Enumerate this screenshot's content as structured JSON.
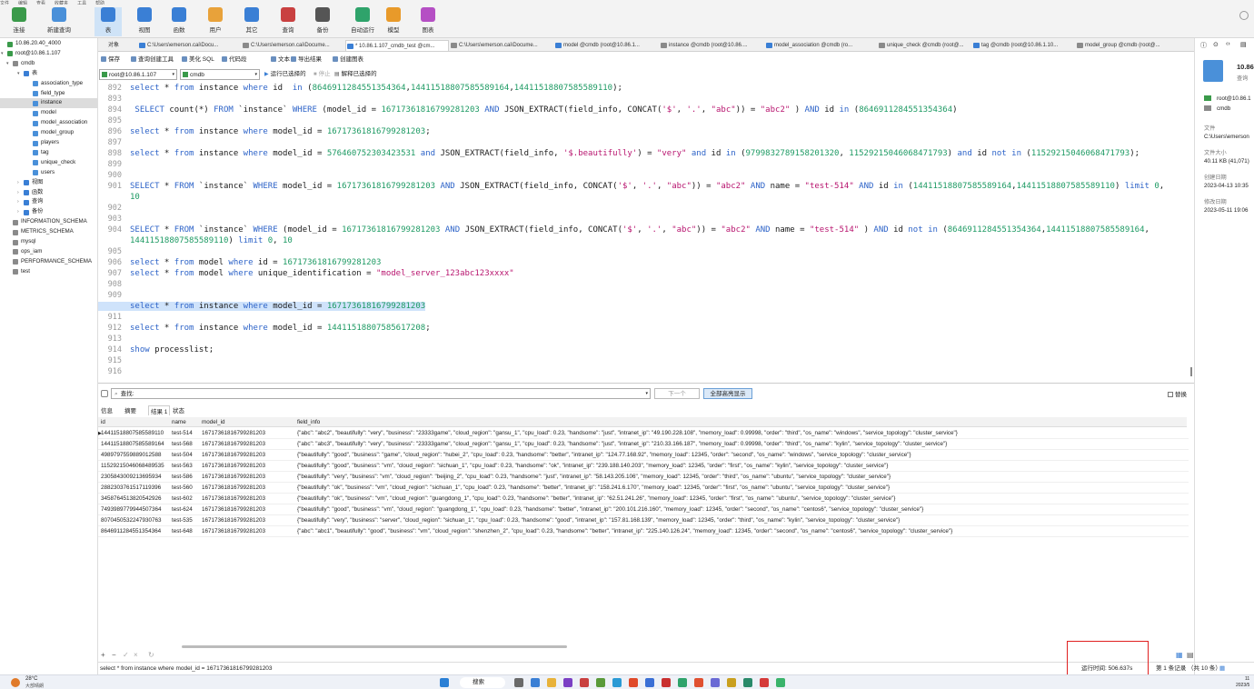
{
  "menubar": [
    "文件",
    "编辑",
    "查看",
    "收藏夹",
    "工具",
    "帮助"
  ],
  "toolbar": {
    "items": [
      {
        "label": "连接",
        "icon": "connect-icon",
        "color": "#3a9a4a"
      },
      {
        "label": "新建查询",
        "icon": "new-query-icon",
        "color": "#4a90d9"
      },
      {
        "label": "表",
        "icon": "table-icon",
        "color": "#3a7fd5"
      },
      {
        "label": "视图",
        "icon": "view-icon",
        "color": "#3a7fd5"
      },
      {
        "label": "函数",
        "icon": "function-icon",
        "color": "#3a7fd5"
      },
      {
        "label": "用户",
        "icon": "user-icon",
        "color": "#e8a23a"
      },
      {
        "label": "其它",
        "icon": "other-icon",
        "color": "#3a7fd5"
      },
      {
        "label": "查询",
        "icon": "query-icon",
        "color": "#c94040"
      },
      {
        "label": "备份",
        "icon": "backup-icon",
        "color": "#555"
      },
      {
        "label": "自动运行",
        "icon": "automation-icon",
        "color": "#2fa36b"
      },
      {
        "label": "模型",
        "icon": "model-icon",
        "color": "#e89a2a"
      },
      {
        "label": "图表",
        "icon": "chart-icon",
        "color": "#b54fc4"
      }
    ]
  },
  "tree": [
    {
      "label": "10.86.20.40_4000",
      "level": 0,
      "type": "connection",
      "expand": ""
    },
    {
      "label": "root@10.86.1.107",
      "level": 0,
      "type": "connection",
      "expand": "▾"
    },
    {
      "label": "cmdb",
      "level": 1,
      "type": "db",
      "expand": "▾"
    },
    {
      "label": "表",
      "level": 2,
      "type": "folder",
      "expand": "▾"
    },
    {
      "label": "association_type",
      "level": 3,
      "type": "table",
      "expand": ""
    },
    {
      "label": "field_type",
      "level": 3,
      "type": "table",
      "expand": ""
    },
    {
      "label": "instance",
      "level": 3,
      "type": "table",
      "expand": "",
      "selected": true
    },
    {
      "label": "model",
      "level": 3,
      "type": "table",
      "expand": ""
    },
    {
      "label": "model_association",
      "level": 3,
      "type": "table",
      "expand": ""
    },
    {
      "label": "model_group",
      "level": 3,
      "type": "table",
      "expand": ""
    },
    {
      "label": "players",
      "level": 3,
      "type": "table",
      "expand": ""
    },
    {
      "label": "tag",
      "level": 3,
      "type": "table",
      "expand": ""
    },
    {
      "label": "unique_check",
      "level": 3,
      "type": "table",
      "expand": ""
    },
    {
      "label": "users",
      "level": 3,
      "type": "table",
      "expand": ""
    },
    {
      "label": "视图",
      "level": 2,
      "type": "folder",
      "expand": "›"
    },
    {
      "label": "函数",
      "level": 2,
      "type": "folder",
      "expand": "›"
    },
    {
      "label": "查询",
      "level": 2,
      "type": "folder",
      "expand": "›"
    },
    {
      "label": "备份",
      "level": 2,
      "type": "folder",
      "expand": "›"
    },
    {
      "label": "INFORMATION_SCHEMA",
      "level": 1,
      "type": "db",
      "expand": ""
    },
    {
      "label": "METRICS_SCHEMA",
      "level": 1,
      "type": "db",
      "expand": ""
    },
    {
      "label": "mysql",
      "level": 1,
      "type": "db",
      "expand": ""
    },
    {
      "label": "ops_iam",
      "level": 1,
      "type": "db",
      "expand": ""
    },
    {
      "label": "PERFORMANCE_SCHEMA",
      "level": 1,
      "type": "db",
      "expand": ""
    },
    {
      "label": "test",
      "level": 1,
      "type": "db",
      "expand": ""
    }
  ],
  "tabs": [
    {
      "label": "对象",
      "active": false
    },
    {
      "label": "C:\\Users\\emerson.cai\\Docu...",
      "active": false
    },
    {
      "label": "C:\\Users\\emerson.cai\\Docume...",
      "active": false
    },
    {
      "label": "* 10.86.1.107_cmdb_test @cm...",
      "active": true
    },
    {
      "label": "C:\\Users\\emerson.cai\\Docume...",
      "active": false
    },
    {
      "label": "model @cmdb (root@10.86.1...",
      "active": false
    },
    {
      "label": "instance @cmdb (root@10.86....",
      "active": false
    },
    {
      "label": "model_association @cmdb (ro...",
      "active": false
    },
    {
      "label": "unique_check @cmdb (root@...",
      "active": false
    },
    {
      "label": "tag @cmdb (root@10.86.1.10...",
      "active": false
    },
    {
      "label": "model_group @cmdb (root@...",
      "active": false
    }
  ],
  "subtoolbar": [
    "保存",
    "查询创建工具",
    "美化 SQL",
    "代码段",
    "文本",
    "导出结果",
    "创建图表"
  ],
  "conbar": {
    "connection": "root@10.86.1.107",
    "database": "cmdb",
    "run": "运行已选择的",
    "stop": "停止",
    "explain": "解释已选择的"
  },
  "editor": [
    {
      "n": "892",
      "t": "select * from instance where id  in (8646911284551354364,14411518807585589164,14411518807585589110);"
    },
    {
      "n": "893",
      "t": ""
    },
    {
      "n": "894",
      "t": " SELECT count(*) FROM `instance` WHERE (model_id = 1671736181679928​1203 AND JSON_EXTRACT(field_info, CONCAT('$', '.', \"abc\")) = \"abc2\" ) AND id in (8646911284551354364)"
    },
    {
      "n": "895",
      "t": ""
    },
    {
      "n": "896",
      "t": "select * from instance where model_id = 16717361816799281203;"
    },
    {
      "n": "897",
      "t": ""
    },
    {
      "n": "898",
      "t": "select * from instance where model_id = 576460752303423531 and JSON_EXTRACT(field_info, '$.beautifully') = \"very\" and id in (9799832789158201320, 11529215046068471793) and id not in (11529215046068471793);"
    },
    {
      "n": "899",
      "t": ""
    },
    {
      "n": "900",
      "t": ""
    },
    {
      "n": "901",
      "t": "SELECT * FROM `instance` WHERE model_id = 16717361816799281203 AND JSON_EXTRACT(field_info, CONCAT('$', '.', \"abc\")) = \"abc2\" AND name = \"test-514\" AND id in (14411518807585589164,14411518807585589110) limit 0,"
    },
    {
      "n": "",
      "t": "10"
    },
    {
      "n": "902",
      "t": ""
    },
    {
      "n": "903",
      "t": ""
    },
    {
      "n": "904",
      "t": "SELECT * FROM `instance` WHERE (model_id = 16717361816799281203 AND JSON_EXTRACT(field_info, CONCAT('$', '.', \"abc\")) = \"abc2\" AND name = \"test-514\" ) AND id not in (8646911284551354364,14411518807585589164,"
    },
    {
      "n": "",
      "t": "14411518807585589110) limit 0, 10"
    },
    {
      "n": "905",
      "t": ""
    },
    {
      "n": "906",
      "t": "select * from model where id = 16717361816799281203"
    },
    {
      "n": "907",
      "t": "select * from model where unique_identification = \"model_server_123abc123xxxx\""
    },
    {
      "n": "908",
      "t": ""
    },
    {
      "n": "909",
      "t": ""
    },
    {
      "n": "910",
      "t": "select * from instance where model_id = 16717361816799281203",
      "hl": true
    },
    {
      "n": "911",
      "t": ""
    },
    {
      "n": "912",
      "t": "select * from instance where model_id = 14411518807585617208;"
    },
    {
      "n": "913",
      "t": ""
    },
    {
      "n": "914",
      "t": "show processlist;"
    },
    {
      "n": "915",
      "t": ""
    },
    {
      "n": "916",
      "t": ""
    }
  ],
  "find": {
    "label": "查找:",
    "next": "下一个",
    "highlight_all": "全部高亮显示",
    "replace": "替换"
  },
  "result_tabs": [
    "信息",
    "摘要",
    "结果 1",
    "状态"
  ],
  "grid": {
    "columns": [
      "id",
      "name",
      "model_id",
      "field_info"
    ],
    "rows": [
      [
        "14411518807585589110",
        "test-514",
        "16717361816799281203",
        "{\"abc\": \"abc2\", \"beautifully\": \"very\", \"business\": \"23333game\", \"cloud_region\": \"gansu_1\", \"cpu_load\": 0.23, \"handsome\": \"just\", \"intranet_ip\": \"49.190.228.108\", \"memory_load\": 0.99998, \"order\": \"third\", \"os_name\": \"windows\", \"service_topology\": \"cluster_service\"}"
      ],
      [
        "14411518807585589164",
        "test-568",
        "16717361816799281203",
        "{\"abc\": \"abc3\", \"beautifully\": \"very\", \"business\": \"23333game\", \"cloud_region\": \"gansu_1\", \"cpu_load\": 0.23, \"handsome\": \"just\", \"intranet_ip\": \"210.33.166.187\", \"memory_load\": 0.99998, \"order\": \"third\", \"os_name\": \"kylin\", \"service_topology\": \"cluster_service\"}"
      ],
      [
        "4989797559889012588",
        "test-504",
        "16717361816799281203",
        "{\"beautifully\": \"good\", \"business\": \"game\", \"cloud_region\": \"hubei_2\", \"cpu_load\": 0.23, \"handsome\": \"better\", \"intranet_ip\": \"124.77.168.92\", \"memory_load\": 12345, \"order\": \"second\", \"os_name\": \"windows\", \"service_topology\": \"cluster_service\"}"
      ],
      [
        "11529215046068489535",
        "test-563",
        "16717361816799281203",
        "{\"beautifully\": \"good\", \"business\": \"vm\", \"cloud_region\": \"sichuan_1\", \"cpu_load\": 0.23, \"handsome\": \"ok\", \"intranet_ip\": \"239.188.140.203\", \"memory_load\": 12345, \"order\": \"first\", \"os_name\": \"kylin\", \"service_topology\": \"cluster_service\"}"
      ],
      [
        "2305843009213695934",
        "test-586",
        "16717361816799281203",
        "{\"beautifully\": \"very\", \"business\": \"vm\", \"cloud_region\": \"beijing_2\", \"cpu_load\": 0.23, \"handsome\": \"just\", \"intranet_ip\": \"58.143.205.106\", \"memory_load\": 12345, \"order\": \"third\", \"os_name\": \"ubuntu\", \"service_topology\": \"cluster_service\"}"
      ],
      [
        "2882303761517119396",
        "test-560",
        "16717361816799281203",
        "{\"beautifully\": \"ok\", \"business\": \"vm\", \"cloud_region\": \"sichuan_1\", \"cpu_load\": 0.23, \"handsome\": \"better\", \"intranet_ip\": \"158.241.6.170\", \"memory_load\": 12345, \"order\": \"first\", \"os_name\": \"ubuntu\", \"service_topology\": \"cluster_service\"}"
      ],
      [
        "3458764513820542926",
        "test-602",
        "16717361816799281203",
        "{\"beautifully\": \"ok\", \"business\": \"vm\", \"cloud_region\": \"guangdong_1\", \"cpu_load\": 0.23, \"handsome\": \"better\", \"intranet_ip\": \"62.51.241.26\", \"memory_load\": 12345, \"order\": \"first\", \"os_name\": \"ubuntu\", \"service_topology\": \"cluster_service\"}"
      ],
      [
        "7493989779944507364",
        "test-624",
        "16717361816799281203",
        "{\"beautifully\": \"good\", \"business\": \"vm\", \"cloud_region\": \"guangdong_1\", \"cpu_load\": 0.23, \"handsome\": \"better\", \"intranet_ip\": \"200.101.216.160\", \"memory_load\": 12345, \"order\": \"second\", \"os_name\": \"centos6\", \"service_topology\": \"cluster_service\"}"
      ],
      [
        "8070450532247930763",
        "test-535",
        "16717361816799281203",
        "{\"beautifully\": \"very\", \"business\": \"server\", \"cloud_region\": \"sichuan_1\", \"cpu_load\": 0.23, \"handsome\": \"good\", \"intranet_ip\": \"157.81.168.139\", \"memory_load\": 12345, \"order\": \"third\", \"os_name\": \"kylin\", \"service_topology\": \"cluster_service\"}"
      ],
      [
        "8646911284551354364",
        "test-648",
        "16717361816799281203",
        "{\"abc\": \"abc1\", \"beautifully\": \"good\", \"business\": \"vm\", \"cloud_region\": \"shenzhen_2\", \"cpu_load\": 0.23, \"handsome\": \"better\", \"intranet_ip\": \"225.140.126.24\", \"memory_load\": 12345, \"order\": \"second\", \"os_name\": \"centos6\", \"service_topology\": \"cluster_service\"}"
      ]
    ]
  },
  "right_panel": {
    "title": "10.86",
    "subtitle": "查询",
    "connection": "root@10.86.1",
    "db": "cmdb",
    "file_label": "文件",
    "file_path": "C:\\Users\\emerson",
    "size_label": "文件大小",
    "size": "40.11 KB (41,071)",
    "created_label": "创建日期",
    "created": "2023-04-13 10:35",
    "modified_label": "修改日期",
    "modified": "2023-05-11 19:06"
  },
  "status": {
    "sql": "select * from instance where model_id = 16717361816799281203",
    "runtime": "运行时间: 506.637s",
    "records": "第 1 条记录 （共 10 条）"
  },
  "taskbar": {
    "temp": "28°C",
    "weather": "大部晴朗",
    "search": "搜索",
    "time": "11",
    "date": "2023/5"
  }
}
